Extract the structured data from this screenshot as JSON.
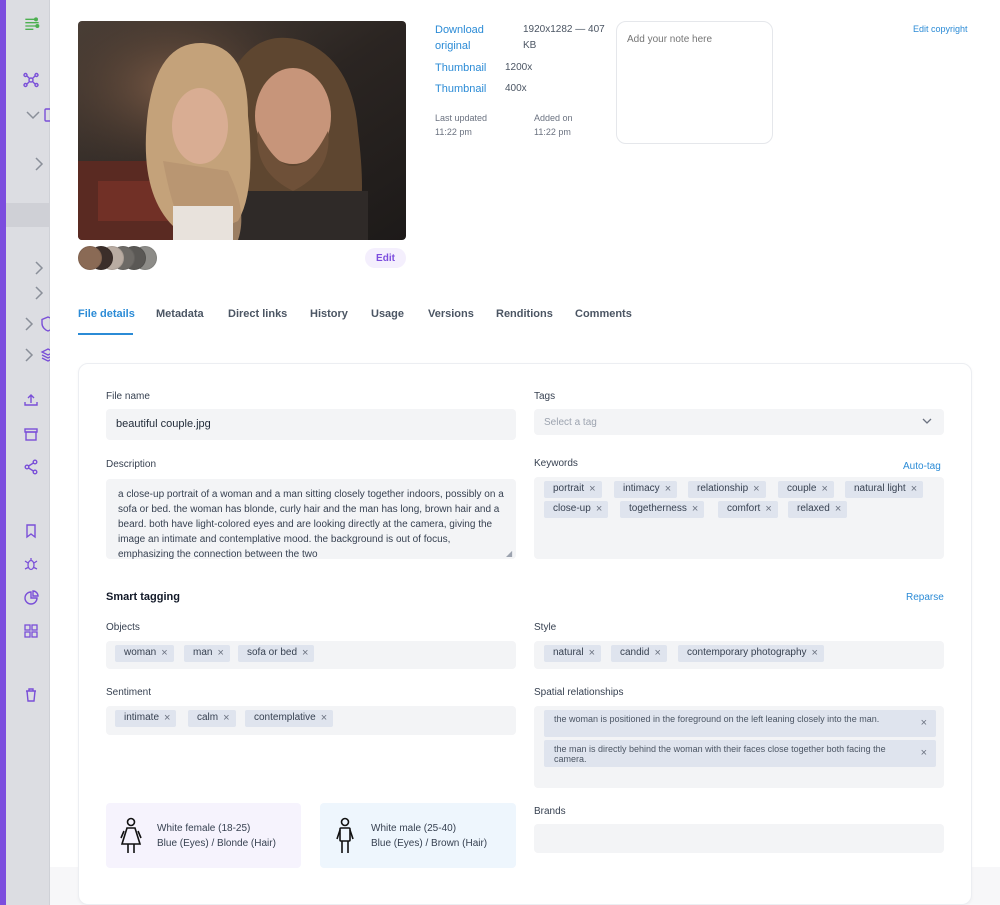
{
  "asset": {
    "links": [
      {
        "label": "Download original",
        "value": "1920x1282 — 407 KB"
      },
      {
        "label": "Thumbnail",
        "value": "1200x"
      },
      {
        "label": "Thumbnail",
        "value": "400x"
      }
    ],
    "last_updated_label": "Last updated",
    "last_updated_value": "11:22 pm",
    "added_on_label": "Added on",
    "added_on_value": "11:22 pm",
    "note_placeholder": "Add your note here",
    "edit_copyright": "Edit copyright",
    "edit_label": "Edit",
    "swatches": [
      "#8a6a55",
      "#3b2e2a",
      "#b9aca2",
      "#6d6a66",
      "#5a5855",
      "#8d8c88"
    ]
  },
  "tabs": [
    "File details",
    "Metadata",
    "Direct links",
    "History",
    "Usage",
    "Versions",
    "Renditions",
    "Comments"
  ],
  "details": {
    "file_name_label": "File name",
    "file_name": "beautiful couple.jpg",
    "tags_label": "Tags",
    "tags_placeholder": "Select a tag",
    "description_label": "Description",
    "description": "a close-up portrait of a woman and a man sitting closely together indoors, possibly on a sofa or bed. the woman has blonde, curly hair and the man has long, brown hair and a beard. both have light-colored eyes and are looking directly at the camera, giving the image an intimate and contemplative mood. the background is out of focus, emphasizing the connection between the two",
    "keywords_label": "Keywords",
    "auto_tag": "Auto-tag",
    "keywords": [
      "portrait",
      "intimacy",
      "relationship",
      "couple",
      "natural light",
      "close-up",
      "togetherness",
      "comfort",
      "relaxed"
    ]
  },
  "smart": {
    "title": "Smart tagging",
    "reparse": "Reparse",
    "objects_label": "Objects",
    "objects": [
      "woman",
      "man",
      "sofa or bed"
    ],
    "style_label": "Style",
    "style": [
      "natural",
      "candid",
      "contemporary photography"
    ],
    "sentiment_label": "Sentiment",
    "sentiment": [
      "intimate",
      "calm",
      "contemplative"
    ],
    "spatial_label": "Spatial relationships",
    "spatial": [
      "the woman is positioned in the foreground on the left leaning closely into the man.",
      "the man is directly behind the woman with their faces close together both facing the camera."
    ],
    "brands_label": "Brands",
    "people": [
      {
        "line1": "White female (18-25)",
        "line2": "Blue (Eyes) / Blonde (Hair)",
        "icon": "female-person-icon",
        "bg": "#f6f3fd"
      },
      {
        "line1": "White male (25-40)",
        "line2": "Blue (Eyes) / Brown (Hair)",
        "icon": "male-person-icon",
        "bg": "#eef6fd"
      }
    ]
  },
  "colors": {
    "accent": "#2b8bd6",
    "brand": "#7c4dde"
  }
}
